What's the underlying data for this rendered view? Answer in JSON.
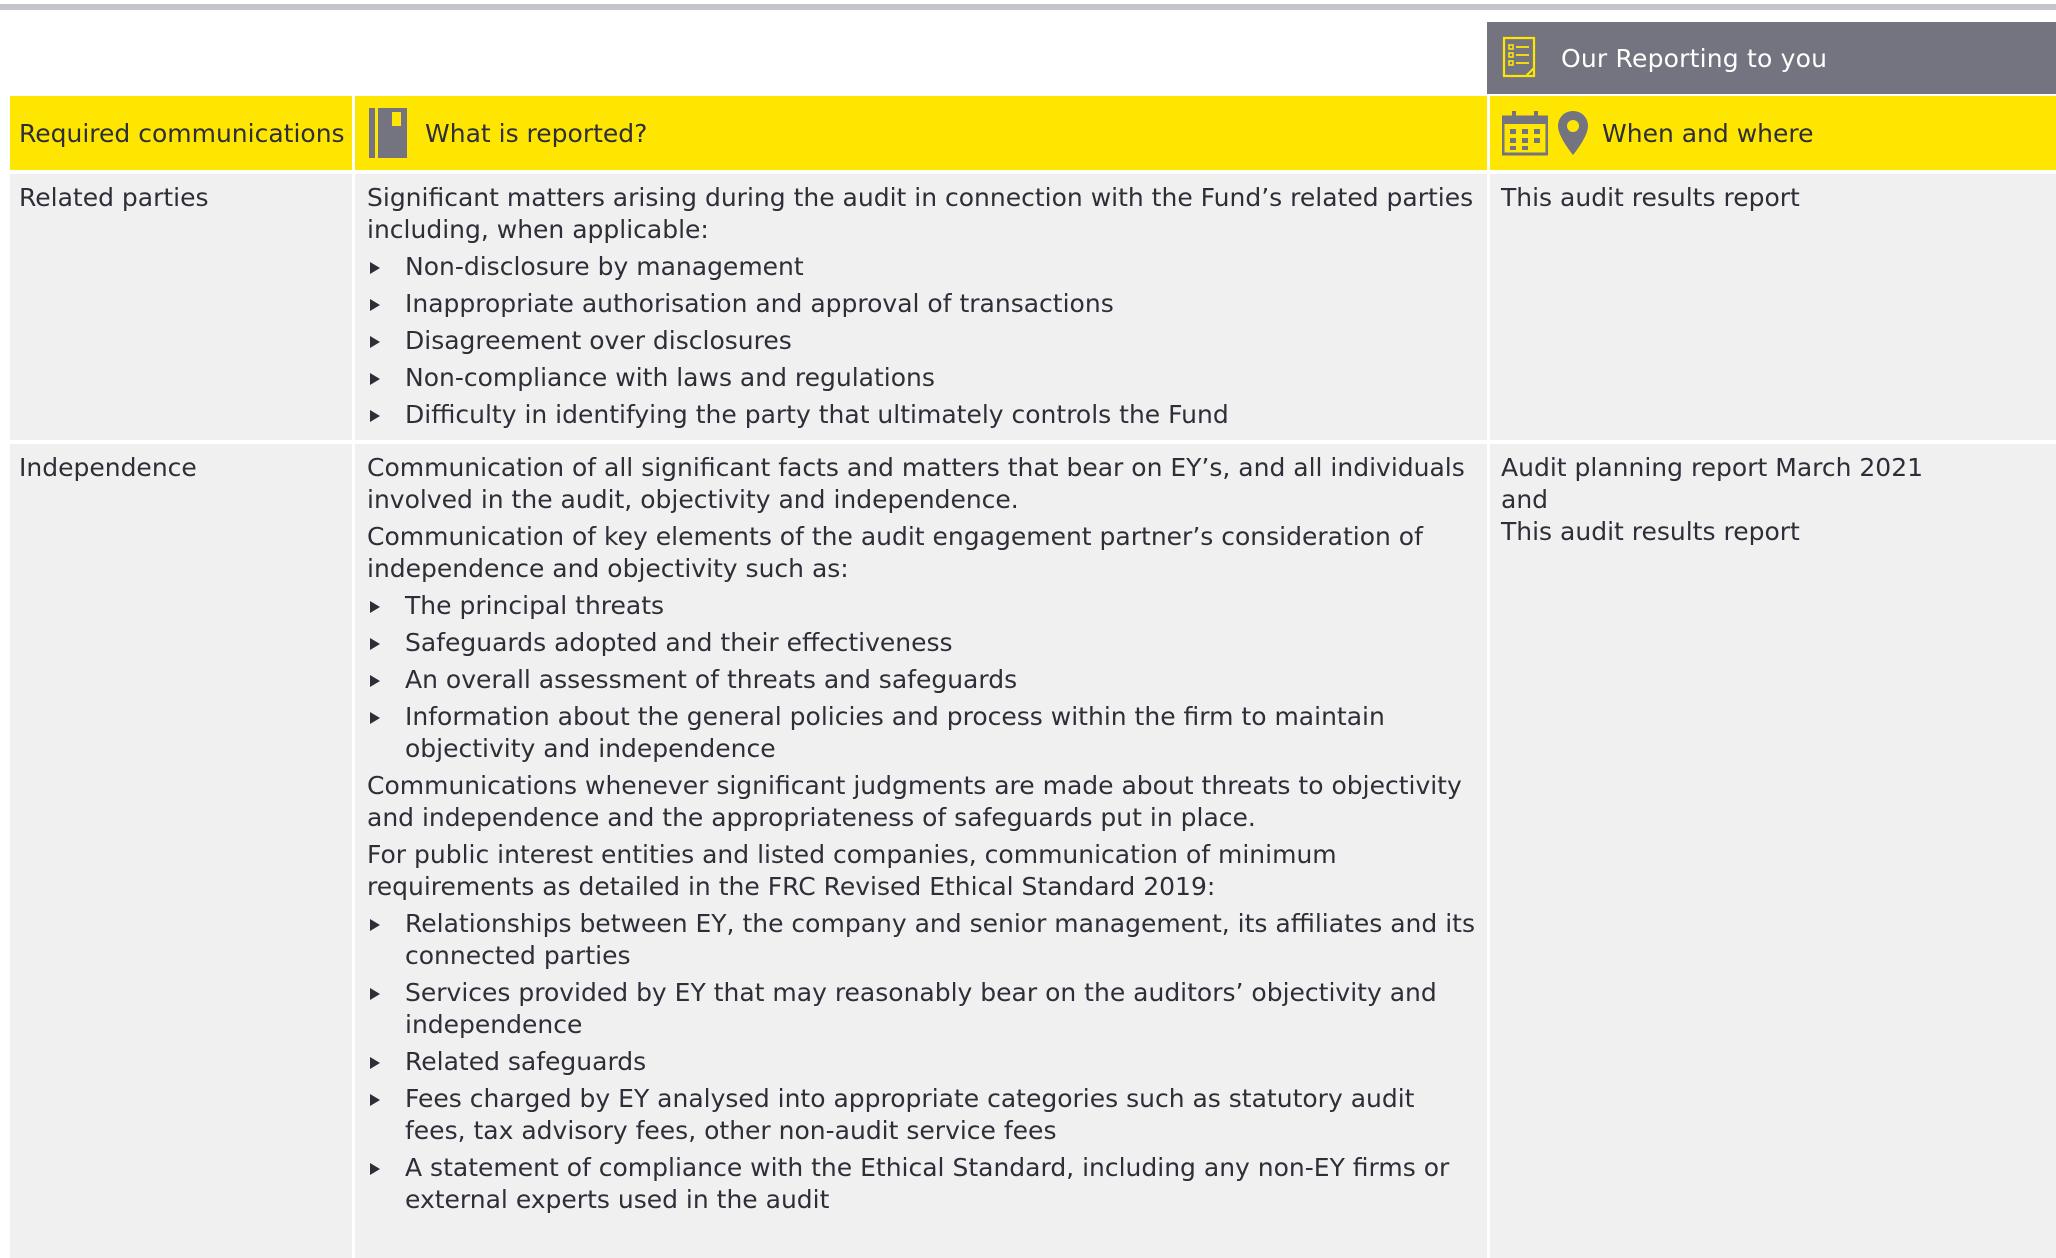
{
  "banner": {
    "title": "Our Reporting to you",
    "icon": "checklist-icon"
  },
  "header": {
    "col1": "Required communications",
    "col2": "What is reported?",
    "col3": "When and where",
    "icons": [
      "notebook-icon",
      "calendar-icon",
      "map-pin-icon"
    ]
  },
  "rows": [
    {
      "label": "Related parties",
      "intro": "Significant matters arising during the audit in connection with the Fund’s related parties including, when applicable:",
      "bullets": [
        "Non-disclosure by management",
        "Inappropriate authorisation and approval of transactions",
        "Disagreement over disclosures",
        "Non-compliance with laws and regulations",
        "Difficulty in identifying the party that ultimately controls the Fund"
      ],
      "when": [
        "This audit results report"
      ]
    },
    {
      "label": "Independence",
      "para1": "Communication of all significant facts and matters that bear on EY’s, and all individuals involved in the audit, objectivity and independence.",
      "para2": "Communication of key elements of the audit engagement partner’s consideration of independence and objectivity such as:",
      "bullets1": [
        "The principal threats",
        "Safeguards adopted and their effectiveness",
        "An overall assessment of threats and safeguards",
        "Information about the general policies and process within the firm to maintain objectivity and independence"
      ],
      "para3": "Communications whenever significant judgments are made about threats to objectivity and independence and the appropriateness of safeguards put in place.",
      "para4": "For public interest entities and listed companies, communication of minimum requirements as detailed in the FRC Revised Ethical Standard 2019:",
      "bullets2": [
        "Relationships between EY, the company and senior management, its affiliates and its connected parties",
        "Services provided by EY that may reasonably bear on the auditors’ objectivity and independence",
        "Related safeguards",
        "Fees charged by EY analysed into appropriate categories such as statutory audit fees, tax advisory fees, other non-audit service fees",
        "A statement of compliance with the Ethical Standard, including any non-EY firms or external experts used in the audit"
      ],
      "when": [
        "Audit planning report March 2021",
        "and",
        "This audit results report"
      ]
    }
  ],
  "colors": {
    "accent": "#ffe600",
    "banner": "#747480",
    "row_bg": "#f0f0f0",
    "text": "#2e2e38",
    "rule": "#c4c4cd"
  }
}
